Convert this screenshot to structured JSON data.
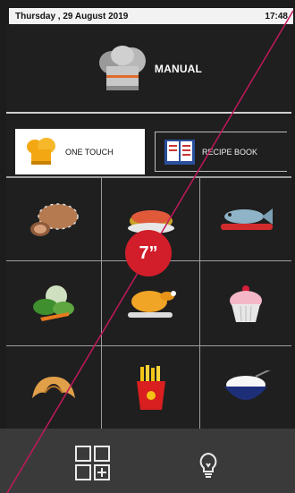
{
  "status_bar": {
    "date": "Thursday , 29 August 2019",
    "time": "17:48"
  },
  "manual": {
    "label": "MANUAL",
    "icon": "chef-hat-icon"
  },
  "tabs": [
    {
      "label": "ONE TOUCH",
      "icon": "chef-hat-icon",
      "selected": true
    },
    {
      "label": "RECIPE BOOK",
      "icon": "recipe-book-icon",
      "selected": false
    }
  ],
  "grid_icons": [
    "meat-roll-icon",
    "pie-icon",
    "fish-icon",
    "vegetables-icon",
    "roast-chicken-icon",
    "cupcake-icon",
    "croissant-icon",
    "fries-icon",
    "rice-bowl-icon"
  ],
  "badge": {
    "text": "7”",
    "color": "#d11e2a"
  },
  "bottom_bar": {
    "icons": [
      "apps-grid-icon",
      "lightbulb-icon"
    ]
  }
}
